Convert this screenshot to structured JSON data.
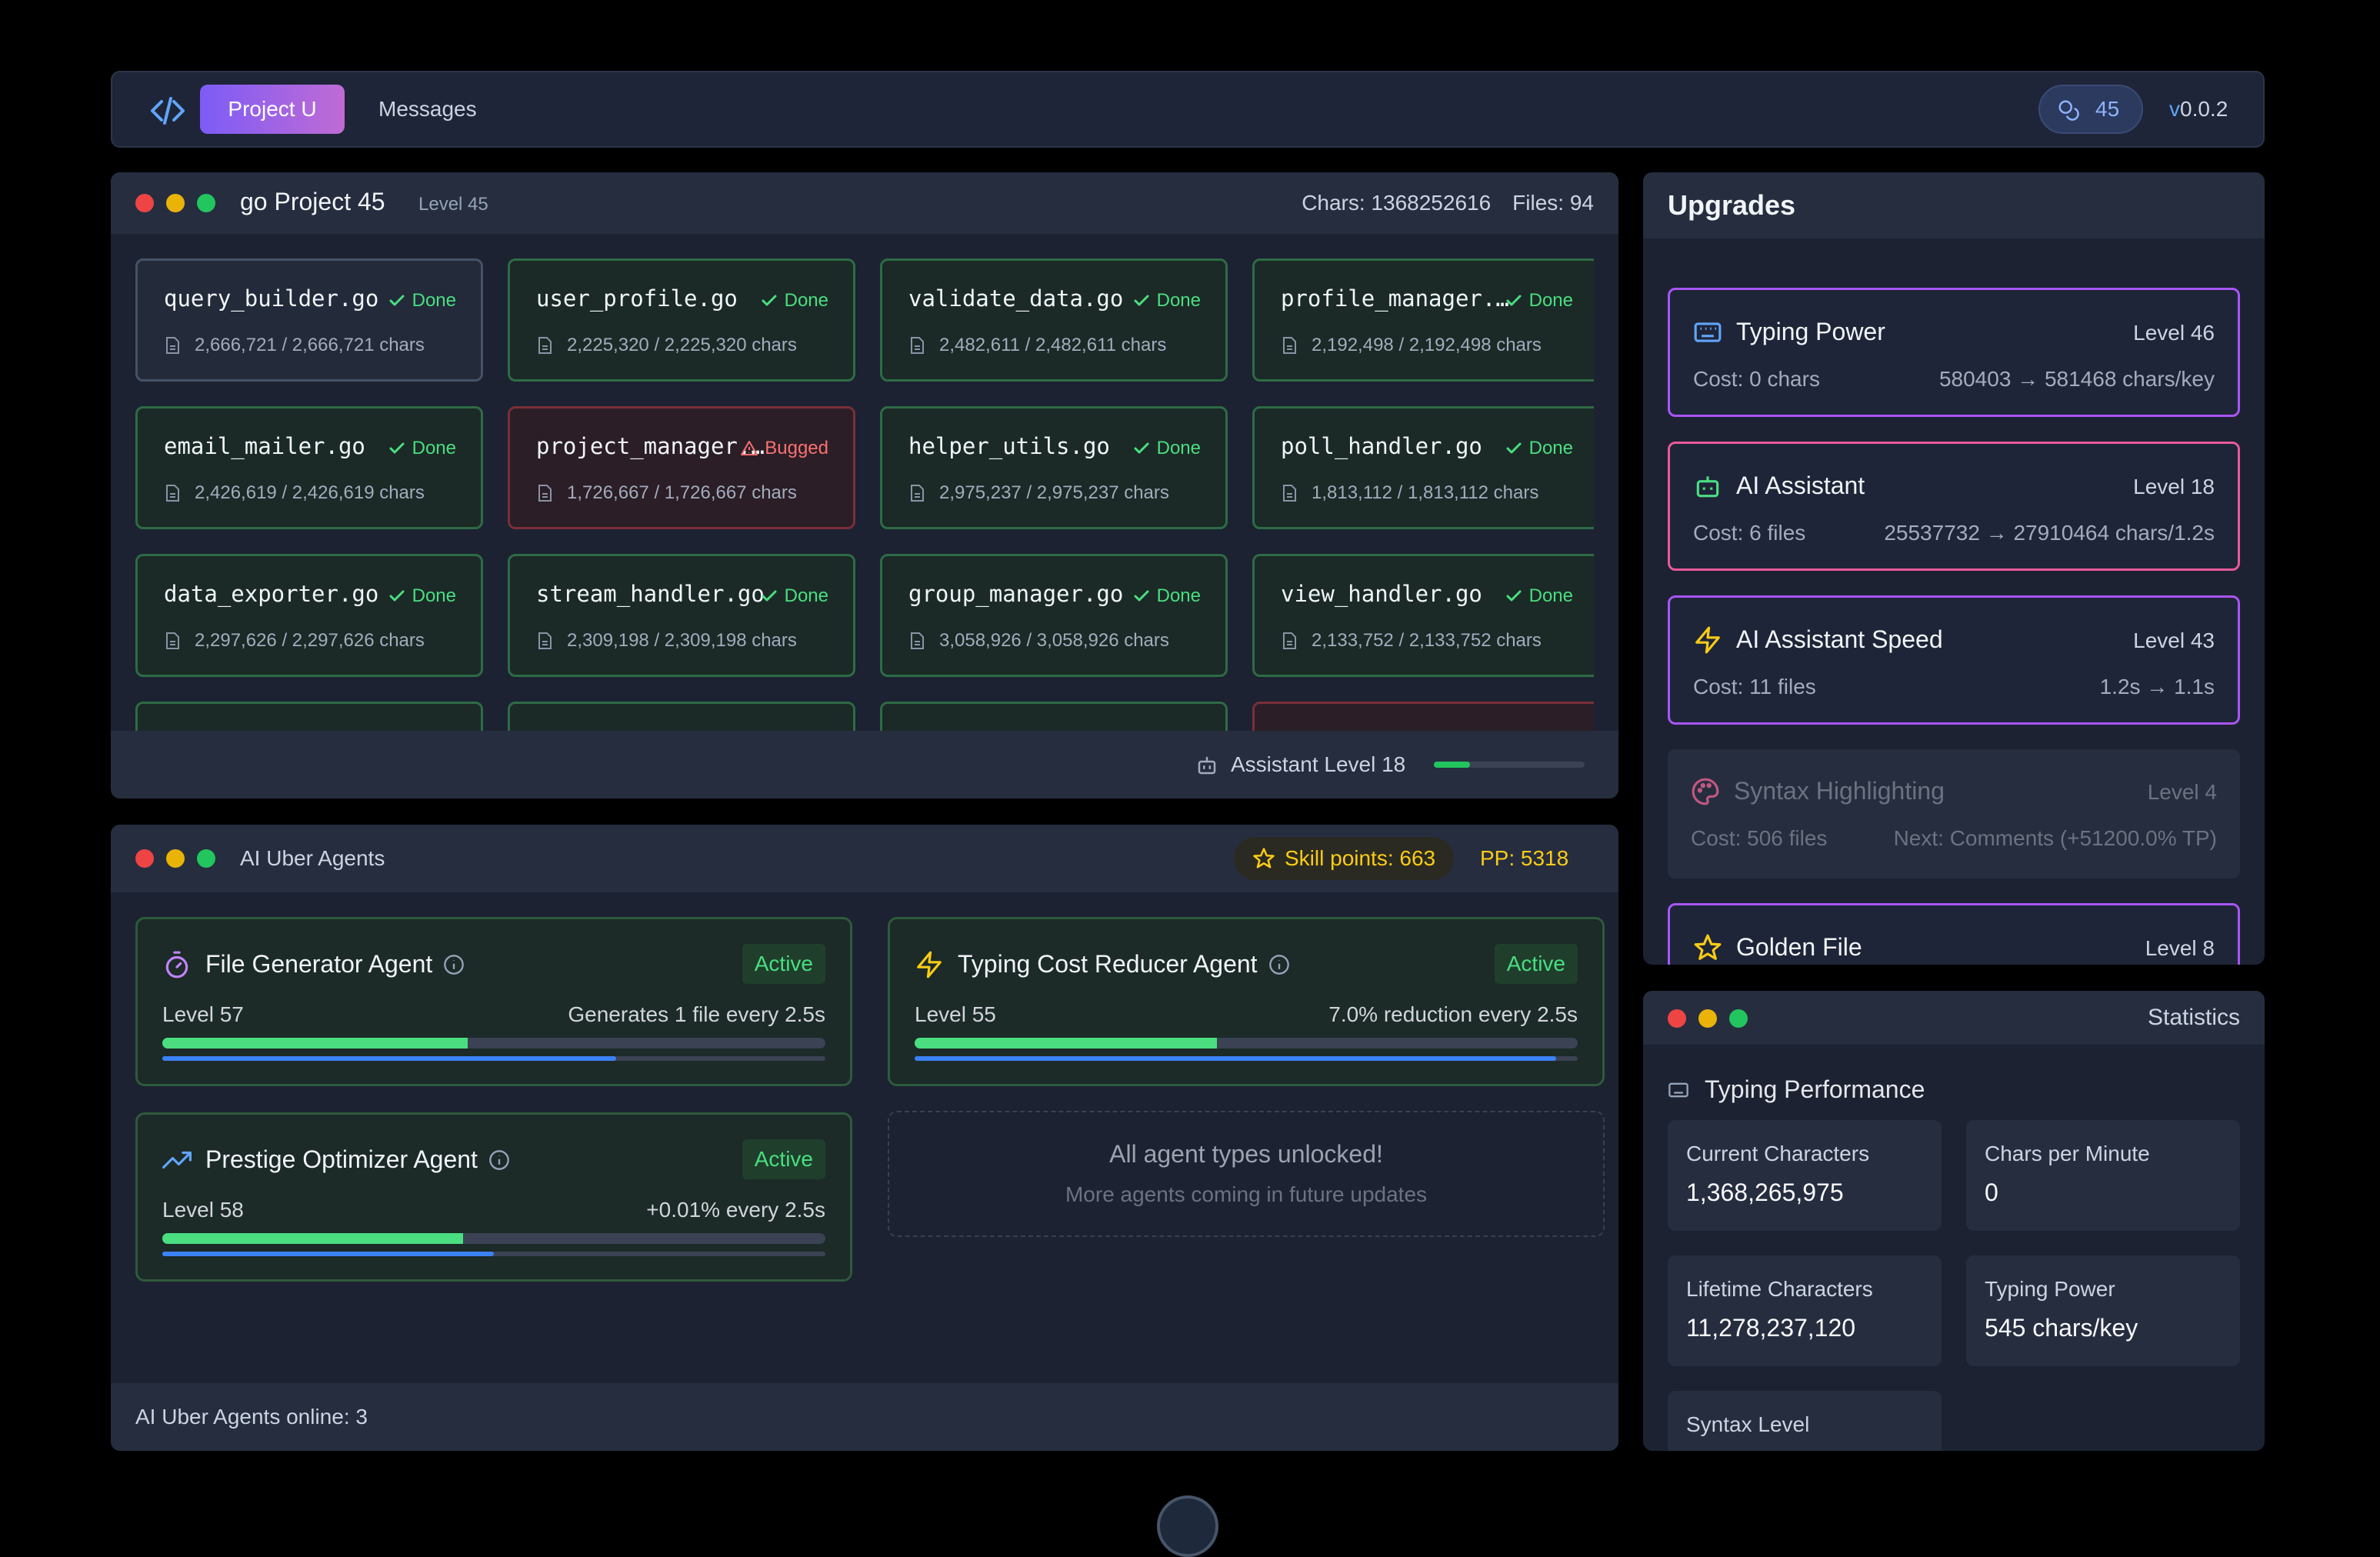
{
  "header": {
    "project_label": "Project U",
    "messages_label": "Messages",
    "coins": "45",
    "version_prefix": "v",
    "version_number": "0.0.2"
  },
  "project": {
    "title": "go Project 45",
    "level": "Level 45",
    "chars": "Chars: 1368252616",
    "files": "Files: 94",
    "files_list": [
      {
        "name": "query_builder.go",
        "status": "Done",
        "chars": "2,666,721 / 2,666,721 chars"
      },
      {
        "name": "user_profile.go",
        "status": "Done",
        "chars": "2,225,320 / 2,225,320 chars"
      },
      {
        "name": "validate_data.go",
        "status": "Done",
        "chars": "2,482,611 / 2,482,611 chars"
      },
      {
        "name": "profile_manager.go",
        "status": "Done",
        "chars": "2,192,498 / 2,192,498 chars"
      },
      {
        "name": "email_mailer.go",
        "status": "Done",
        "chars": "2,426,619 / 2,426,619 chars"
      },
      {
        "name": "project_manager.go",
        "status": "Bugged",
        "chars": "1,726,667 / 1,726,667 chars"
      },
      {
        "name": "helper_utils.go",
        "status": "Done",
        "chars": "2,975,237 / 2,975,237 chars"
      },
      {
        "name": "poll_handler.go",
        "status": "Done",
        "chars": "1,813,112 / 1,813,112 chars"
      },
      {
        "name": "data_exporter.go",
        "status": "Done",
        "chars": "2,297,626 / 2,297,626 chars"
      },
      {
        "name": "stream_handler.go",
        "status": "Done",
        "chars": "2,309,198 / 2,309,198 chars"
      },
      {
        "name": "group_manager.go",
        "status": "Done",
        "chars": "3,058,926 / 3,058,926 chars"
      },
      {
        "name": "view_handler.go",
        "status": "Done",
        "chars": "2,133,752 / 2,133,752 chars"
      }
    ],
    "assistant_label": "Assistant Level 18",
    "assistant_progress": 0.24
  },
  "agents": {
    "title": "AI Uber Agents",
    "skill_points": "Skill points: 663",
    "pp": "PP: 5318",
    "items": [
      {
        "name": "File Generator Agent",
        "icon": "timer-icon",
        "status": "Active",
        "level": "Level 57",
        "desc": "Generates 1 file every 2.5s",
        "progress": 0.46,
        "cycle": 0.685
      },
      {
        "name": "Typing Cost Reducer Agent",
        "icon": "lightning-icon",
        "status": "Active",
        "level": "Level 55",
        "desc": "7.0% reduction every 2.5s",
        "progress": 0.456,
        "cycle": 0.968
      },
      {
        "name": "Prestige Optimizer Agent",
        "icon": "trending-up-icon",
        "status": "Active",
        "level": "Level 58",
        "desc": "+0.01% every 2.5s",
        "progress": 0.454,
        "cycle": 0.5
      }
    ],
    "unlock_title": "All agent types unlocked!",
    "unlock_sub": "More agents coming in future updates",
    "online": "AI Uber Agents online: 3"
  },
  "upgrades": {
    "title": "Upgrades",
    "items": [
      {
        "name": "Typing Power",
        "level": "Level 46",
        "cost": "Cost: 0 chars",
        "effect": "580403 → 581468 chars/key"
      },
      {
        "name": "AI Assistant",
        "level": "Level 18",
        "cost": "Cost: 6 files",
        "effect": "25537732 → 27910464 chars/1.2s"
      },
      {
        "name": "AI Assistant Speed",
        "level": "Level 43",
        "cost": "Cost: 11 files",
        "effect": "1.2s → 1.1s"
      },
      {
        "name": "Syntax Highlighting",
        "level": "Level 4",
        "cost": "Cost: 506 files",
        "effect": "Next: Comments (+51200.0% TP)"
      },
      {
        "name": "Golden File",
        "level": "Level 8",
        "cost": "",
        "effect": ""
      }
    ]
  },
  "stats": {
    "title": "Statistics",
    "section": "Typing Performance",
    "boxes": [
      {
        "label": "Current Characters",
        "value": "1,368,265,975"
      },
      {
        "label": "Chars per Minute",
        "value": "0"
      },
      {
        "label": "Lifetime Characters",
        "value": "11,278,237,120"
      },
      {
        "label": "Typing Power",
        "value": "545 chars/key"
      },
      {
        "label": "Syntax Level",
        "value": ""
      }
    ]
  },
  "colors": {
    "accent_gradient": [
      "#7c5cf6",
      "#c06bd4"
    ],
    "done": "#4ade80",
    "bugged": "#f87171",
    "gold": "#facc15"
  }
}
